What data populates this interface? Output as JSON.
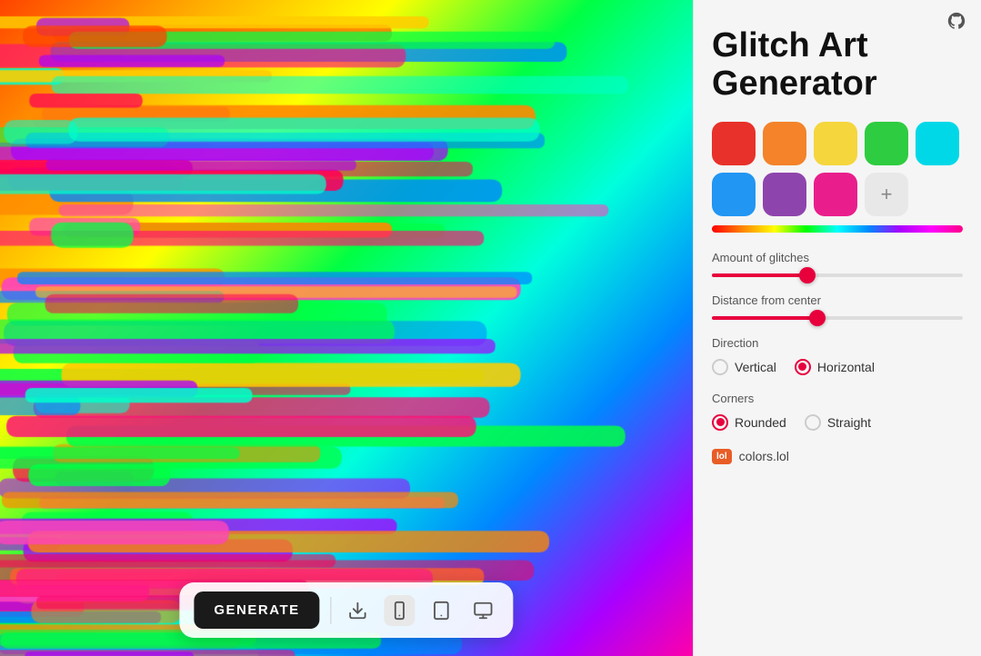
{
  "app": {
    "title": "Glitch Art Generator"
  },
  "panel": {
    "title_line1": "Glitch Art",
    "title_line2": "Generator",
    "colors": [
      {
        "hex": "#e8312a",
        "label": "red"
      },
      {
        "hex": "#f4832a",
        "label": "orange"
      },
      {
        "hex": "#f5d63d",
        "label": "yellow"
      },
      {
        "hex": "#2ecc40",
        "label": "green"
      },
      {
        "hex": "#00d8e8",
        "label": "cyan"
      },
      {
        "hex": "#2196f3",
        "label": "blue"
      },
      {
        "hex": "#8e44ad",
        "label": "purple"
      },
      {
        "hex": "#e91e8c",
        "label": "pink"
      }
    ],
    "add_color_label": "+",
    "amount_of_glitches": "Amount of glitches",
    "distance_from_center": "Distance from center",
    "direction_label": "Direction",
    "direction_options": [
      {
        "label": "Vertical",
        "value": "vertical",
        "checked": false
      },
      {
        "label": "Horizontal",
        "value": "horizontal",
        "checked": true
      }
    ],
    "corners_label": "Corners",
    "corners_options": [
      {
        "label": "Rounded",
        "value": "rounded",
        "checked": true
      },
      {
        "label": "Straight",
        "value": "straight",
        "checked": false
      }
    ],
    "colors_lol_text": "colors.lol",
    "glitches_slider_pct": 38,
    "distance_slider_pct": 42
  },
  "toolbar": {
    "generate_label": "GENERATE",
    "download_tooltip": "Download",
    "mobile_tooltip": "Mobile",
    "tablet_tooltip": "Tablet",
    "desktop_tooltip": "Desktop"
  },
  "github": {
    "url": "#",
    "label": "GitHub"
  }
}
